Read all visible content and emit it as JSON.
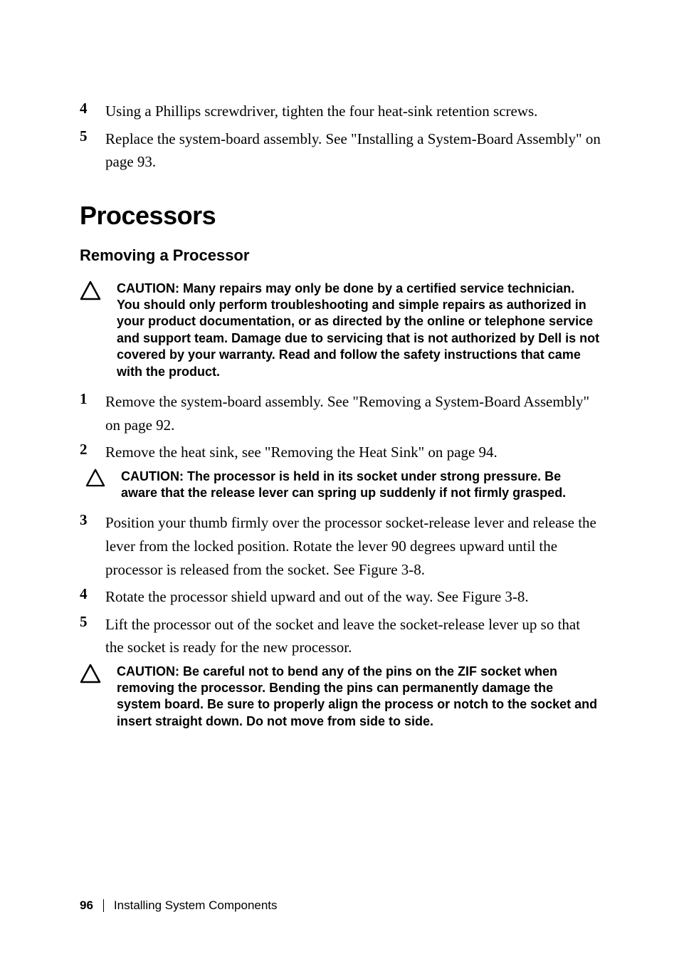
{
  "top_list": {
    "item4": {
      "num": "4",
      "text": "Using a Phillips screwdriver, tighten the four heat-sink retention screws."
    },
    "item5": {
      "num": "5",
      "text": "Replace the system-board assembly. See \"Installing a System-Board Assembly\" on page 93."
    }
  },
  "heading": "Processors",
  "subheading": "Removing a Processor",
  "caution1": "CAUTION: Many repairs may only be done by a certified service technician. You should only perform troubleshooting and simple repairs as authorized in your product documentation, or as directed by the online or telephone service and support team. Damage due to servicing that is not authorized by Dell is not covered by your warranty. Read and follow the safety instructions that came with the product.",
  "mid_list": {
    "item1": {
      "num": "1",
      "text": "Remove the system-board assembly. See \"Removing a System-Board Assembly\" on page 92."
    },
    "item2": {
      "num": "2",
      "text": "Remove the heat sink, see \"Removing the Heat Sink\" on page 94."
    }
  },
  "caution2": "CAUTION: The processor is held in its socket under strong pressure. Be aware that the release lever can spring up suddenly if not firmly grasped.",
  "lower_list": {
    "item3": {
      "num": "3",
      "text": "Position your thumb firmly over the processor socket-release lever and release the lever from the locked position. Rotate the lever 90 degrees upward until the processor is released from the socket. See Figure 3-8."
    },
    "item4": {
      "num": "4",
      "text": "Rotate the processor shield upward and out of the way. See Figure 3-8."
    },
    "item5": {
      "num": "5",
      "text": "Lift the processor out of the socket and leave the socket-release lever up so that the socket is ready for the new processor."
    }
  },
  "caution3": "CAUTION: Be careful not to bend any of the pins on the ZIF socket when removing the processor. Bending the pins can permanently damage the system board. Be sure to properly align the process or notch to the socket and insert straight down. Do not move from side to side.",
  "footer": {
    "page": "96",
    "section": "Installing System Components"
  }
}
